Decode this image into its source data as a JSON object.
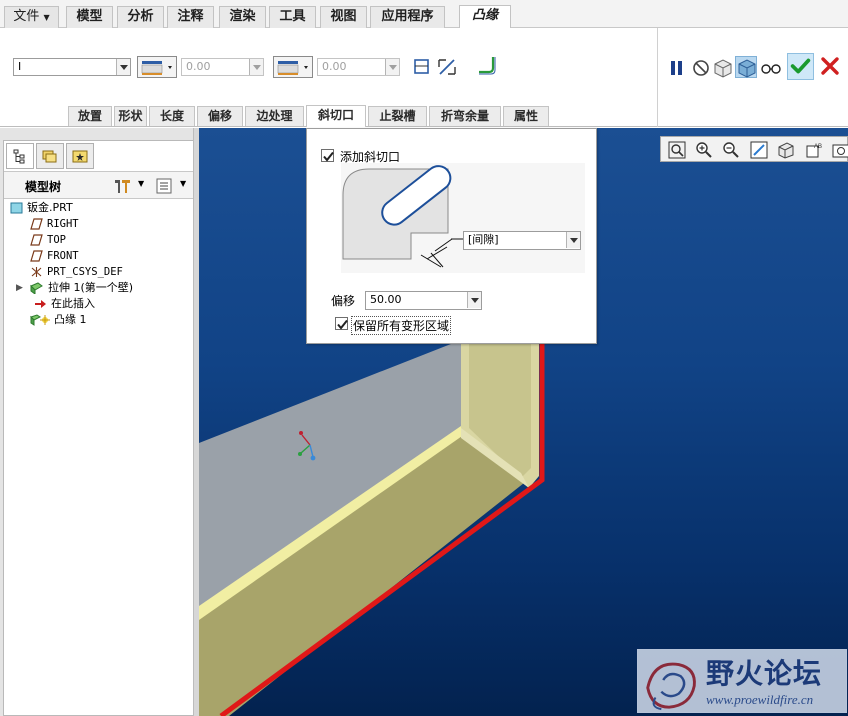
{
  "menu": {
    "file": "文件",
    "tabs": [
      "模型",
      "分析",
      "注释",
      "渲染",
      "工具",
      "视图",
      "应用程序"
    ],
    "active_tab": "凸缘"
  },
  "ribbon": {
    "shape_select": "I",
    "length_value_1": "0.00",
    "length_value_2": "0.00",
    "sub_tabs": [
      "放置",
      "形状",
      "长度",
      "偏移",
      "边处理",
      "斜切口",
      "止裂槽",
      "折弯余量",
      "属性"
    ],
    "active_sub_tab": "斜切口"
  },
  "model_tree": {
    "title": "模型树",
    "nodes": [
      {
        "label": "钣金.PRT",
        "icon": "part-icon"
      },
      {
        "label": "RIGHT",
        "icon": "datum-plane-icon"
      },
      {
        "label": "TOP",
        "icon": "datum-plane-icon"
      },
      {
        "label": "FRONT",
        "icon": "datum-plane-icon"
      },
      {
        "label": "PRT_CSYS_DEF",
        "icon": "csys-icon"
      },
      {
        "label": "拉伸 1(第一个壁)",
        "icon": "extrude-wall-icon"
      },
      {
        "label": "在此插入",
        "icon": "insert-here-arrow-icon"
      },
      {
        "label": "凸缘 1",
        "icon": "flange-icon"
      }
    ]
  },
  "miter_panel": {
    "add_miter_label": "添加斜切口",
    "add_miter_checked": true,
    "gap_select": "[间隙]",
    "offset_label": "偏移",
    "offset_value": "50.00",
    "keep_deform_label": "保留所有变形区域",
    "keep_deform_checked": true
  },
  "watermark": {
    "title": "野火论坛",
    "url": "www.proewildfire.cn"
  },
  "colors": {
    "ok_green": "#1a9a2e",
    "cancel_red": "#d02020",
    "viewport_blue": "#114386",
    "edge_red": "#e01818",
    "wall_gray": "#9aa1a9",
    "wall_olive": "#a8a46a"
  }
}
